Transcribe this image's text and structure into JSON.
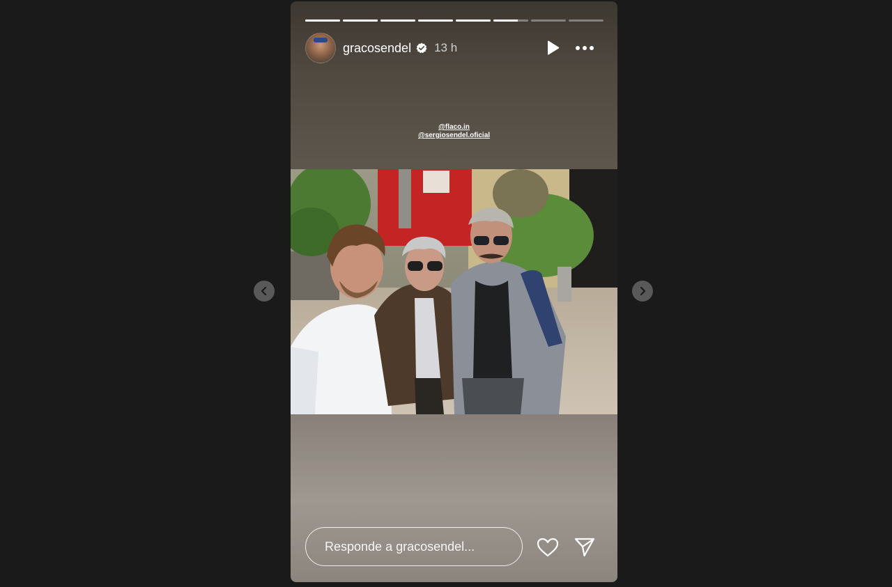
{
  "story": {
    "progress": [
      1,
      1,
      1,
      1,
      1,
      0.7,
      0,
      0
    ],
    "user": {
      "username": "gracosendel",
      "verified": true,
      "time_ago": "13 h"
    },
    "mentions": [
      "@flaco.in",
      "@sergiosendel.oficial"
    ],
    "photo": {
      "subject": "selfie of three men in front of a red door with plants"
    }
  },
  "reply": {
    "placeholder": "Responde a gracosendel..."
  },
  "icons": {
    "play": "play-icon",
    "more": "more-horizontal-icon",
    "like": "heart-icon",
    "share": "send-icon",
    "prev": "chevron-left-icon",
    "next": "chevron-right-icon",
    "verified": "verified-badge-icon"
  },
  "colors": {
    "background": "#1a1a1a",
    "verified": "#ffffff",
    "door": "#c42424"
  }
}
